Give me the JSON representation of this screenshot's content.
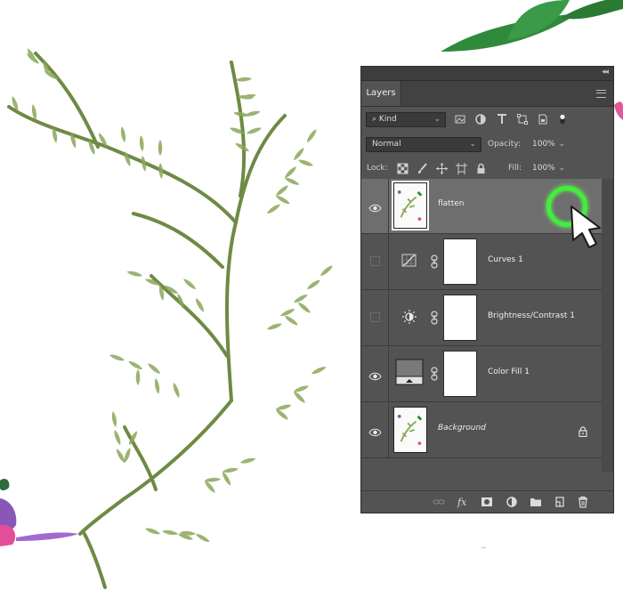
{
  "panel": {
    "tab_label": "Layers",
    "filter": {
      "kind_label": "Kind"
    },
    "blend": {
      "mode": "Normal",
      "opacity_label": "Opacity:",
      "opacity_value": "100%"
    },
    "lock_row": {
      "lock_label": "Lock:",
      "fill_label": "Fill:",
      "fill_value": "100%"
    },
    "layers": [
      {
        "name": "flatten",
        "visible": true,
        "selected": true,
        "type": "pixel"
      },
      {
        "name": "Curves 1",
        "visible": false,
        "selected": false,
        "type": "curves-adjustment"
      },
      {
        "name": "Brightness/Contrast 1",
        "visible": false,
        "selected": false,
        "type": "brightness-adjustment"
      },
      {
        "name": "Color Fill 1",
        "visible": true,
        "selected": false,
        "type": "color-fill"
      },
      {
        "name": "Background",
        "visible": true,
        "selected": false,
        "type": "background",
        "locked": true
      }
    ]
  },
  "colors": {
    "panel_bg": "#535353",
    "selected_row": "#6e6e6e",
    "highlight_ring": "#3ff03a",
    "fern_green": "#7c9a4e"
  },
  "icons": [
    "search-icon",
    "image-filter-icon",
    "adjustment-filter-icon",
    "type-filter-icon",
    "shape-filter-icon",
    "smart-object-filter-icon",
    "filter-toggle-icon",
    "lock-transparent-icon",
    "lock-brush-icon",
    "lock-position-icon",
    "lock-artboard-icon",
    "lock-all-icon",
    "eye-icon",
    "link-icon",
    "lock-icon",
    "fx-icon",
    "add-mask-icon",
    "new-adjustment-icon",
    "new-group-icon",
    "new-layer-icon",
    "trash-icon",
    "pointer-cursor-icon"
  ]
}
